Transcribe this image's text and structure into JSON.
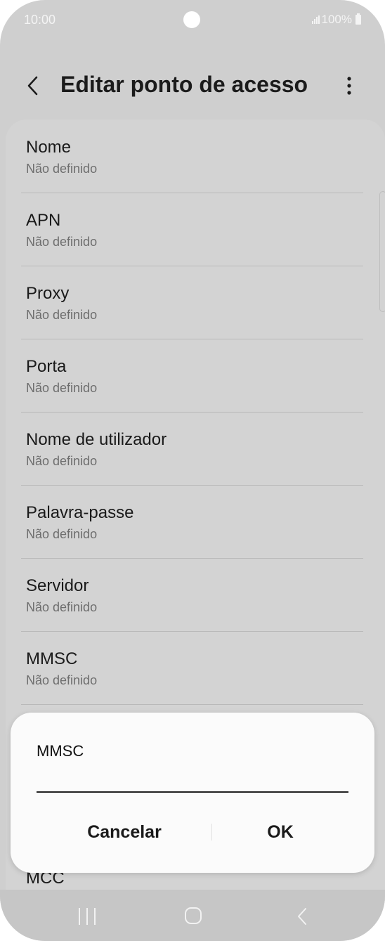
{
  "status_bar": {
    "time": "10:00",
    "battery": "100%"
  },
  "header": {
    "title": "Editar ponto de acesso",
    "back_icon": "chevron-left-icon",
    "more_icon": "more-vertical-icon"
  },
  "items": [
    {
      "title": "Nome",
      "value": "Não definido"
    },
    {
      "title": "APN",
      "value": "Não definido"
    },
    {
      "title": "Proxy",
      "value": "Não definido"
    },
    {
      "title": "Porta",
      "value": "Não definido"
    },
    {
      "title": "Nome de utilizador",
      "value": "Não definido"
    },
    {
      "title": "Palavra-passe",
      "value": "Não definido"
    },
    {
      "title": "Servidor",
      "value": "Não definido"
    },
    {
      "title": "MMSC",
      "value": "Não definido"
    },
    {
      "title": "MCC"
    }
  ],
  "dialog": {
    "title": "MMSC",
    "input_value": "",
    "cancel_label": "Cancelar",
    "ok_label": "OK"
  },
  "colors": {
    "dim_background": "#cfcfcf",
    "dialog_background": "#fbfbfb",
    "text_primary": "#1b1b1b",
    "text_secondary": "#6e6e6e"
  }
}
